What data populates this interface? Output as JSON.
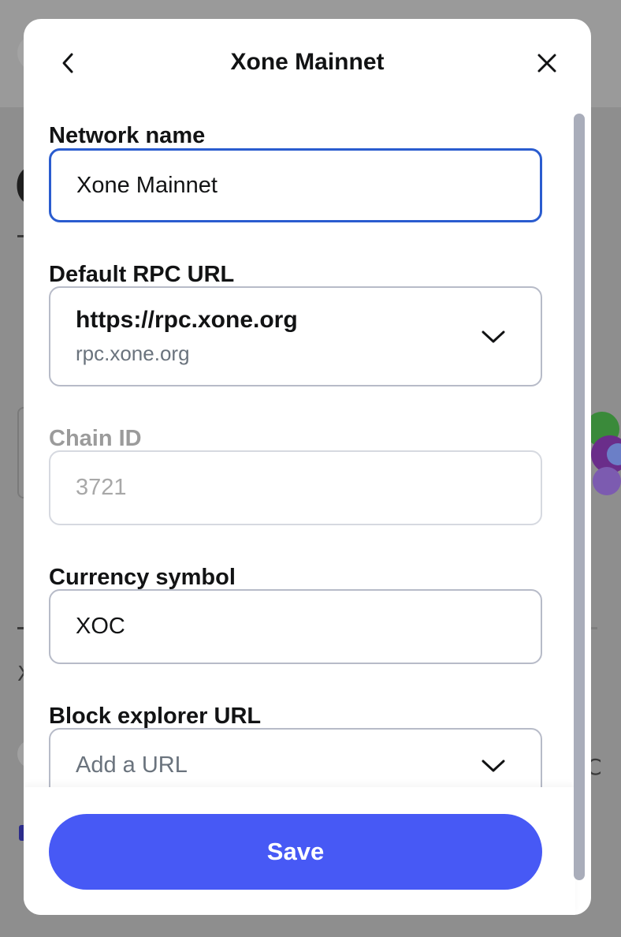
{
  "modal": {
    "title": "Xone Mainnet",
    "back_icon": "chevron-left-icon",
    "close_icon": "close-icon"
  },
  "fields": {
    "network_name": {
      "label": "Network name",
      "value": "Xone Mainnet"
    },
    "rpc_url": {
      "label": "Default RPC URL",
      "value": "https://rpc.xone.org",
      "subtext": "rpc.xone.org"
    },
    "chain_id": {
      "label": "Chain ID",
      "value": "3721"
    },
    "currency_symbol": {
      "label": "Currency symbol",
      "value": "XOC"
    },
    "block_explorer": {
      "label": "Block explorer URL",
      "placeholder": "Add a URL"
    }
  },
  "footer": {
    "save_label": "Save"
  },
  "colors": {
    "accent": "#4759f5",
    "focus_border": "#2a5ccf",
    "backdrop": "#8e8e8e"
  }
}
